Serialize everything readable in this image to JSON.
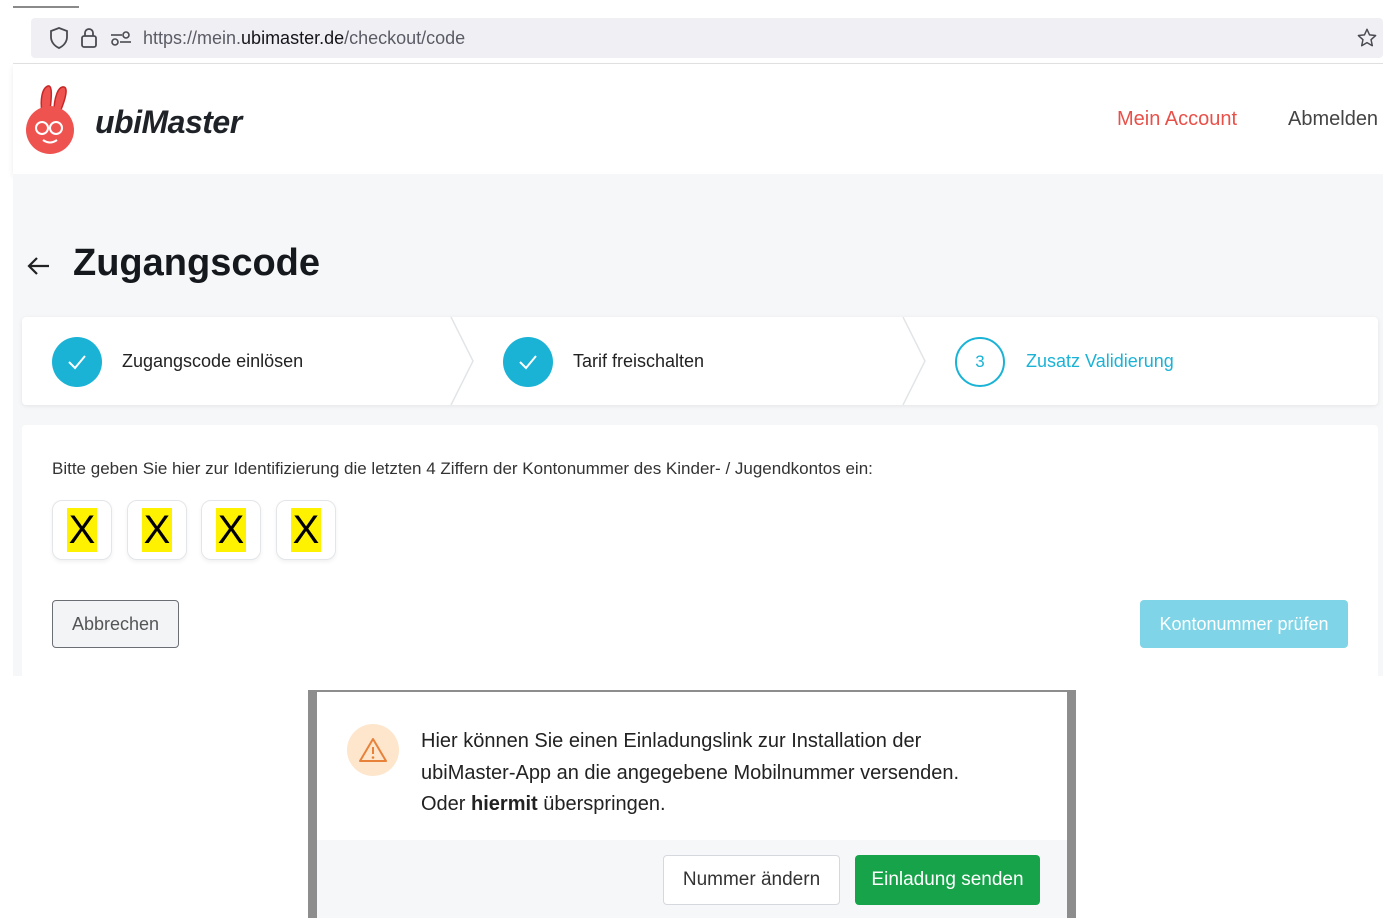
{
  "browser": {
    "url_prefix": "https://mein.",
    "url_domain": "ubimaster.de",
    "url_path": "/checkout/code"
  },
  "header": {
    "logo_text": "ubiMaster",
    "nav_account": "Mein Account",
    "nav_logout": "Abmelden",
    "accent_color": "#e8514a"
  },
  "page": {
    "title": "Zugangscode"
  },
  "stepper": {
    "steps": [
      {
        "label": "Zugangscode einlösen",
        "state": "done"
      },
      {
        "label": "Tarif freischalten",
        "state": "done"
      },
      {
        "label": "Zusatz Validierung",
        "state": "active",
        "number": "3"
      }
    ],
    "active_color": "#1ab3d6"
  },
  "form": {
    "instruction": "Bitte geben Sie hier zur Identifizierung die letzten 4 Ziffern der Kontonummer des Kinder- / Jugendkontos ein:",
    "digits": [
      "X",
      "X",
      "X",
      "X"
    ],
    "cancel_label": "Abbrechen",
    "check_label": "Kontonummer prüfen"
  },
  "dialog": {
    "line1": "Hier können Sie einen Einladungslink zur Installation der",
    "line2": "ubiMaster-App an die angegebene Mobilnummer versenden.",
    "line3_prefix": "Oder ",
    "line3_link": "hiermit",
    "line3_suffix": " überspringen.",
    "change_label": "Nummer ändern",
    "send_label": "Einladung senden",
    "send_color": "#17a34a"
  }
}
